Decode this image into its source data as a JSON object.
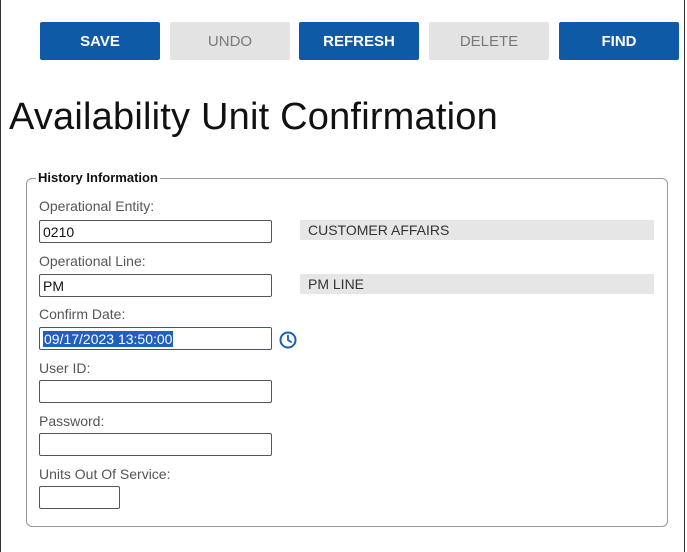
{
  "toolbar": {
    "save": "SAVE",
    "undo": "UNDO",
    "refresh": "REFRESH",
    "delete": "DELETE",
    "find": "FIND"
  },
  "page": {
    "title": "Availability Unit Confirmation"
  },
  "history": {
    "legend": "History Information",
    "operational_entity": {
      "label": "Operational Entity:",
      "value": "0210",
      "description": "CUSTOMER AFFAIRS"
    },
    "operational_line": {
      "label": "Operational Line:",
      "value": "PM",
      "description": "PM LINE"
    },
    "confirm_date": {
      "label": "Confirm Date:",
      "value": "09/17/2023 13:50:00"
    },
    "user_id": {
      "label": "User ID:",
      "value": ""
    },
    "password": {
      "label": "Password:",
      "value": ""
    },
    "units_out_of_service": {
      "label": "Units Out Of Service:",
      "value": ""
    }
  },
  "colors": {
    "primary_button": "#0f5aa6",
    "disabled_button": "#e3e3e3",
    "selection": "#1f5fbf"
  },
  "icons": {
    "confirm_date_picker": "clock-icon"
  }
}
